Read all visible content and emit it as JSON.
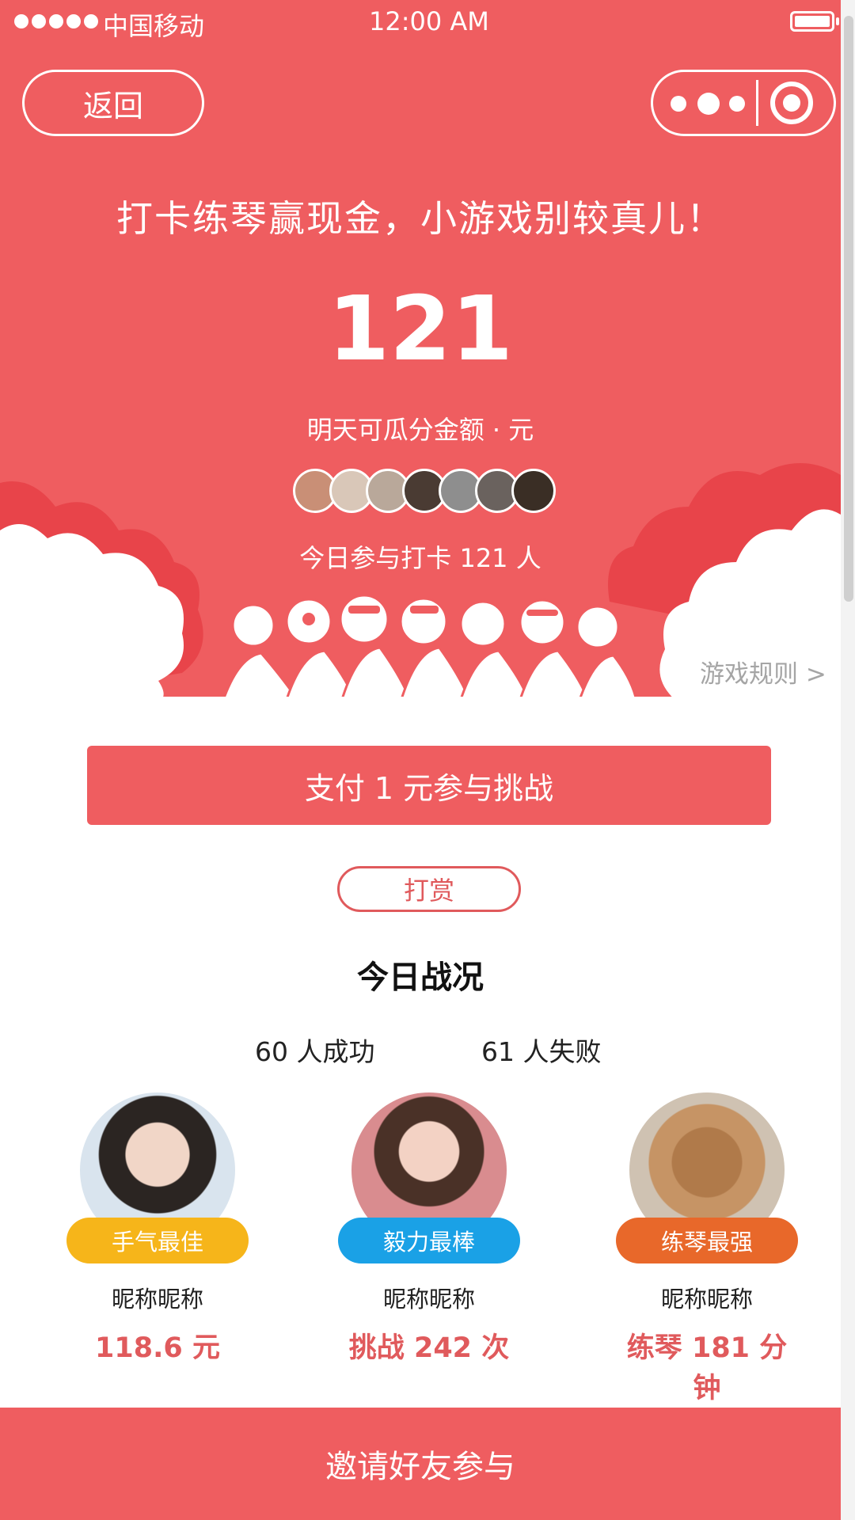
{
  "status_bar": {
    "carrier": "中国移动",
    "time": "12:00 AM"
  },
  "nav": {
    "back_label": "返回"
  },
  "hero": {
    "slogan": "打卡练琴赢现金，小游戏别较真儿！",
    "amount": "121",
    "amount_label": "明天可瓜分金额 · 元",
    "participants": "今日参与打卡 121 人",
    "avatar_colors": [
      "#c98f76",
      "#d9c7b8",
      "#b9a89a",
      "#4a3b33",
      "#8e8e8e",
      "#6a625e",
      "#3a2e25"
    ]
  },
  "rules_link": "游戏规则 >",
  "actions": {
    "pay_label": "支付 1 元参与挑战",
    "tip_label": "打赏"
  },
  "stats": {
    "title": "今日战况",
    "success": "60 人成功",
    "fail": "61 人失败"
  },
  "winners": [
    {
      "badge": "手气最佳",
      "badge_color": "#f6b51a",
      "nickname": "昵称昵称",
      "result": "118.6 元"
    },
    {
      "badge": "毅力最棒",
      "badge_color": "#1aa1e6",
      "nickname": "昵称昵称",
      "result": "挑战 242 次"
    },
    {
      "badge": "练琴最强",
      "badge_color": "#e8682a",
      "nickname": "昵称昵称",
      "result": "练琴 181 分钟"
    }
  ],
  "invite_label": "邀请好友参与",
  "colors": {
    "brand": "#ef5d60",
    "accent_text": "#e05a5c"
  }
}
